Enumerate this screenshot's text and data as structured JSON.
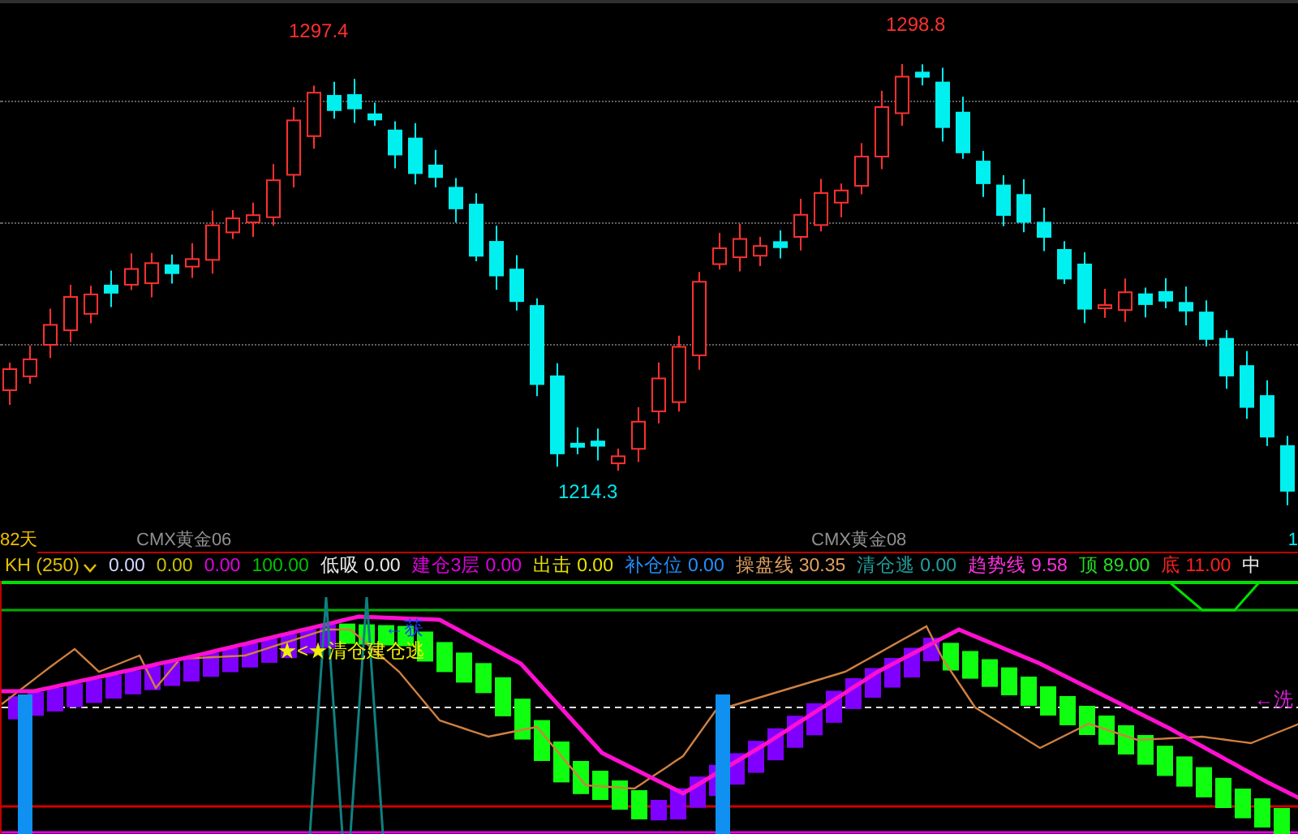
{
  "price_chart": {
    "high_labels": [
      {
        "text": "1297.4"
      },
      {
        "text": "1298.8"
      }
    ],
    "low_label": "1214.3"
  },
  "period_row": {
    "days": "82天",
    "contracts": [
      "CMX黄金06",
      "CMX黄金08"
    ],
    "edge_value": "1"
  },
  "legend": [
    {
      "kind": "selector",
      "label": "KH (250)",
      "color": "#e0c000"
    },
    {
      "kind": "field",
      "value": "0.00",
      "color": "#d0d8ff"
    },
    {
      "kind": "field",
      "value": "0.00",
      "color": "#c8c000"
    },
    {
      "kind": "field",
      "value": "0.00",
      "color": "#e000e0"
    },
    {
      "kind": "field",
      "value": "100.00",
      "color": "#00c000"
    },
    {
      "kind": "field",
      "label": "低吸",
      "value": "0.00",
      "color": "#e8e8e8"
    },
    {
      "kind": "field",
      "label": "建仓3层",
      "value": "0.00",
      "color": "#e000e0"
    },
    {
      "kind": "field",
      "label": "出击",
      "value": "0.00",
      "color": "#e8e000"
    },
    {
      "kind": "field",
      "label": "补仓位",
      "value": "0.00",
      "color": "#2090ff"
    },
    {
      "kind": "field",
      "label": "操盘线",
      "value": "30.35",
      "color": "#e0a060"
    },
    {
      "kind": "field",
      "label": "清仓逃",
      "value": "0.00",
      "color": "#20a0a0"
    },
    {
      "kind": "field",
      "label": "趋势线",
      "value": "9.58",
      "color": "#ff30e0"
    },
    {
      "kind": "field",
      "label": "顶",
      "value": "89.00",
      "color": "#20e020"
    },
    {
      "kind": "field",
      "label": "底",
      "value": "11.00",
      "color": "#ff2020"
    },
    {
      "kind": "field",
      "label": "中",
      "color": "#e8e8e8"
    }
  ],
  "indicator_panel": {
    "signals": [
      {
        "text": "←获",
        "color": "#2040ff"
      },
      {
        "text": "★<★清仓建仓逃",
        "color": "#f0f000"
      },
      {
        "text": "←洗",
        "color": "#e020e0"
      }
    ]
  }
}
